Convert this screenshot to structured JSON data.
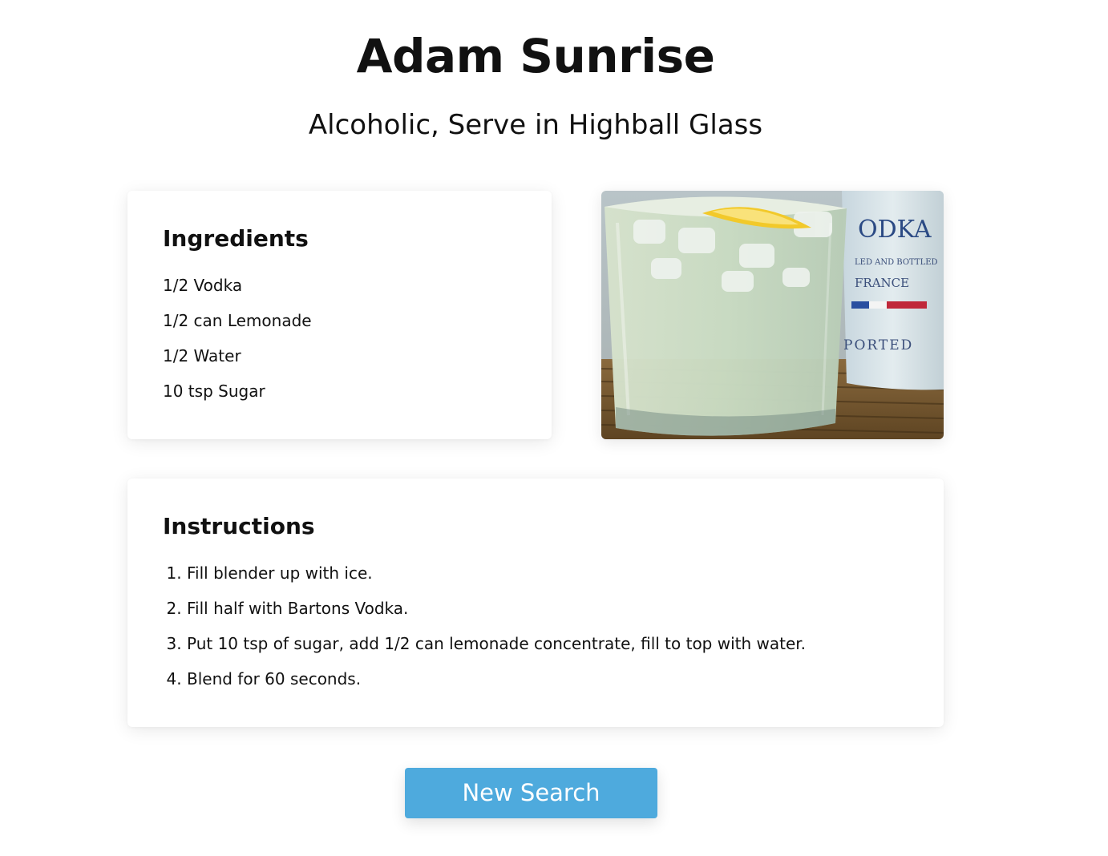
{
  "drink": {
    "title": "Adam Sunrise",
    "subtitle": "Alcoholic, Serve in Highball Glass"
  },
  "ingredients": {
    "heading": "Ingredients",
    "items": [
      "1/2 Vodka",
      "1/2 can Lemonade",
      "1/2 Water",
      "10 tsp Sugar"
    ]
  },
  "photo": {
    "label_top": "ODKA",
    "label_mid": "LED AND BOTTLED",
    "label_country": "FRANCE",
    "label_bottom": "PORTED"
  },
  "instructions": {
    "heading": "Instructions",
    "steps": [
      "Fill blender up with ice.",
      "Fill half with Bartons Vodka.",
      "Put 10 tsp of sugar, add 1/2 can lemonade concentrate, fill to top with water.",
      "Blend for 60 seconds."
    ]
  },
  "actions": {
    "new_search_label": "New Search"
  },
  "colors": {
    "button": "#4eaadd",
    "text": "#111111",
    "background": "#ffffff"
  }
}
